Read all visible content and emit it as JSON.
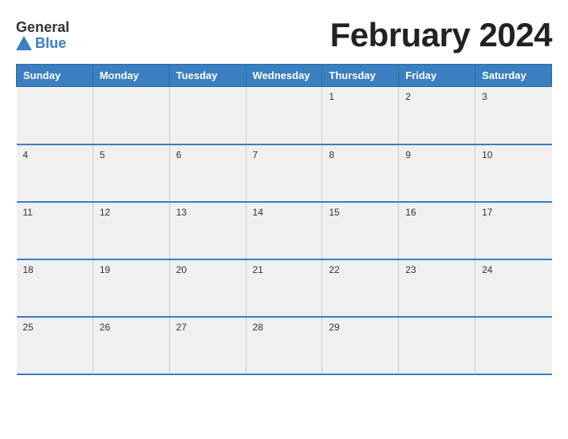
{
  "header": {
    "logo": {
      "general_text": "General",
      "blue_text": "Blue"
    },
    "title": "February 2024"
  },
  "calendar": {
    "weekdays": [
      "Sunday",
      "Monday",
      "Tuesday",
      "Wednesday",
      "Thursday",
      "Friday",
      "Saturday"
    ],
    "weeks": [
      [
        {
          "day": "",
          "empty": true
        },
        {
          "day": "",
          "empty": true
        },
        {
          "day": "",
          "empty": true
        },
        {
          "day": "",
          "empty": true
        },
        {
          "day": "1",
          "empty": false
        },
        {
          "day": "2",
          "empty": false
        },
        {
          "day": "3",
          "empty": false
        }
      ],
      [
        {
          "day": "4",
          "empty": false
        },
        {
          "day": "5",
          "empty": false
        },
        {
          "day": "6",
          "empty": false
        },
        {
          "day": "7",
          "empty": false
        },
        {
          "day": "8",
          "empty": false
        },
        {
          "day": "9",
          "empty": false
        },
        {
          "day": "10",
          "empty": false
        }
      ],
      [
        {
          "day": "11",
          "empty": false
        },
        {
          "day": "12",
          "empty": false
        },
        {
          "day": "13",
          "empty": false
        },
        {
          "day": "14",
          "empty": false
        },
        {
          "day": "15",
          "empty": false
        },
        {
          "day": "16",
          "empty": false
        },
        {
          "day": "17",
          "empty": false
        }
      ],
      [
        {
          "day": "18",
          "empty": false
        },
        {
          "day": "19",
          "empty": false
        },
        {
          "day": "20",
          "empty": false
        },
        {
          "day": "21",
          "empty": false
        },
        {
          "day": "22",
          "empty": false
        },
        {
          "day": "23",
          "empty": false
        },
        {
          "day": "24",
          "empty": false
        }
      ],
      [
        {
          "day": "25",
          "empty": false
        },
        {
          "day": "26",
          "empty": false
        },
        {
          "day": "27",
          "empty": false
        },
        {
          "day": "28",
          "empty": false
        },
        {
          "day": "29",
          "empty": false
        },
        {
          "day": "",
          "empty": true
        },
        {
          "day": "",
          "empty": true
        }
      ]
    ]
  }
}
